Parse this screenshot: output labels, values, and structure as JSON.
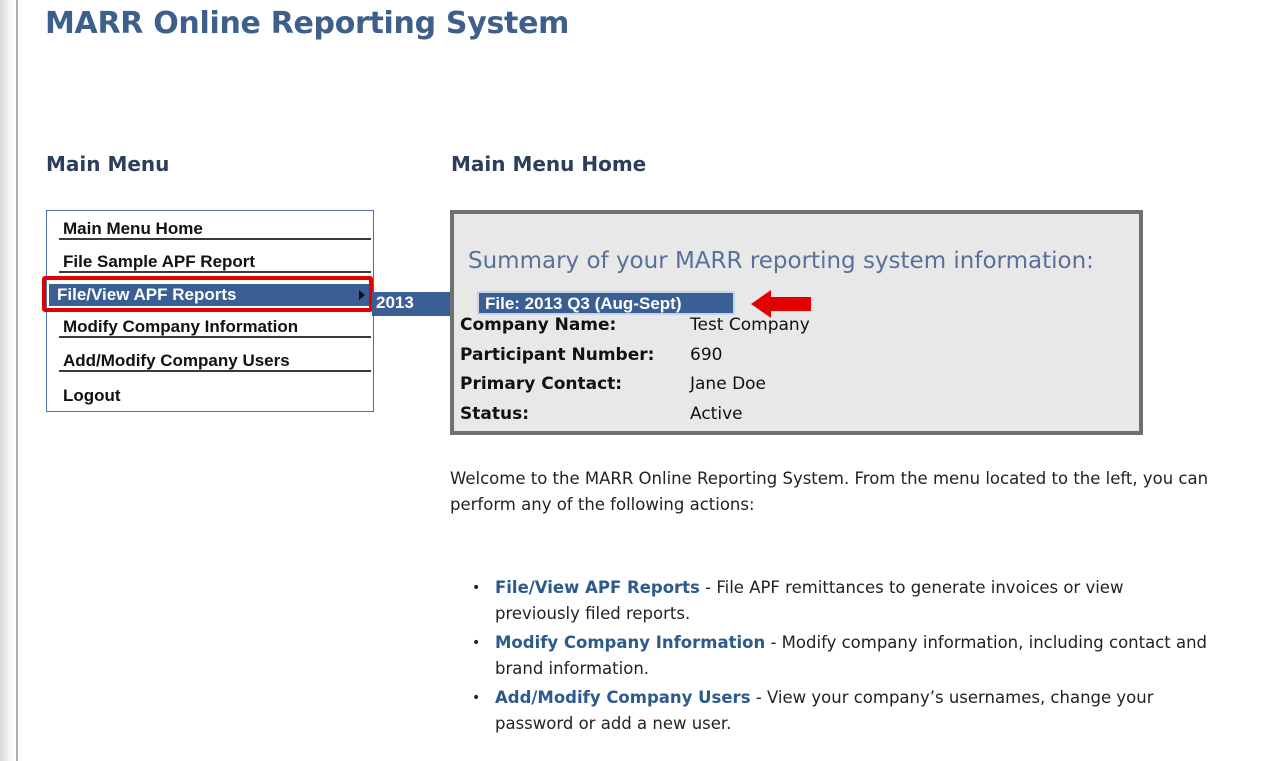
{
  "app": {
    "title": "MARR Online Reporting System"
  },
  "menu": {
    "heading": "Main Menu",
    "items": [
      {
        "label": "Main Menu Home"
      },
      {
        "label": "File Sample APF Report"
      },
      {
        "label": "File/View APF Reports"
      },
      {
        "label": "Modify Company Information"
      },
      {
        "label": "Add/Modify Company Users"
      },
      {
        "label": "Logout"
      }
    ],
    "submenu": {
      "year": "2013",
      "file": "File: 2013 Q3 (Aug-Sept)"
    }
  },
  "content": {
    "heading": "Main Menu Home",
    "summary": {
      "title": "Summary of your MARR reporting system information:",
      "fields": [
        {
          "label": "Company Name:",
          "value": "Test Company"
        },
        {
          "label": "Participant Number:",
          "value": "690"
        },
        {
          "label": "Primary Contact:",
          "value": "Jane Doe"
        },
        {
          "label": "Status:",
          "value": "Active"
        }
      ]
    },
    "welcome": "Welcome to the MARR Online Reporting System. From the menu located to the left, you can perform any of the following actions:",
    "actions": [
      {
        "link": "File/View APF Reports",
        "desc": " - File APF remittances to generate invoices or view previously filed reports."
      },
      {
        "link": "Modify Company Information",
        "desc": " - Modify company information, including contact and brand information."
      },
      {
        "link": "Add/Modify Company Users",
        "desc": " - View your company’s usernames, change your password or add a new user."
      }
    ]
  },
  "colors": {
    "accent_blue": "#3a5f94",
    "title_blue": "#3e5f8a",
    "link_blue": "#2d5a8c",
    "highlight_red": "#e20000"
  }
}
